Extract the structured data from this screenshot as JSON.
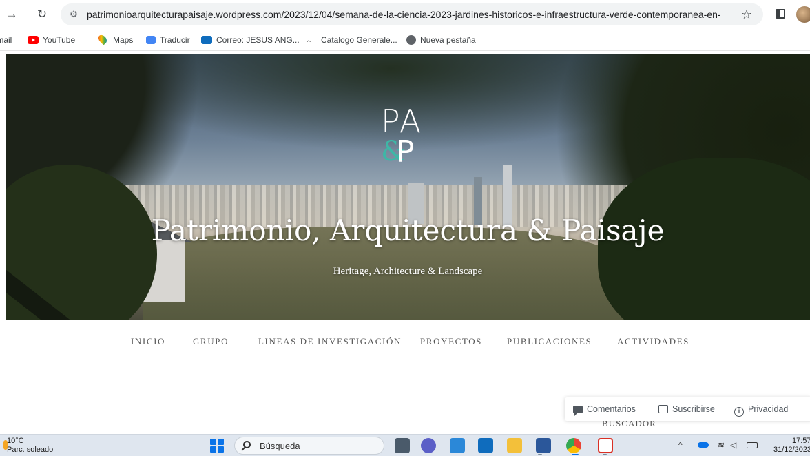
{
  "browser": {
    "url": "patrimonioarquitecturapaisaje.wordpress.com/2023/12/04/semana-de-la-ciencia-2023-jardines-historicos-e-infraestructura-verde-contemporanea-en-ma...",
    "bookmarks": [
      {
        "label": "Gmail",
        "icon": "gmail-icon"
      },
      {
        "label": "YouTube",
        "icon": "youtube-icon"
      },
      {
        "label": "Maps",
        "icon": "maps-icon"
      },
      {
        "label": "Traducir",
        "icon": "translate-icon"
      },
      {
        "label": "Correo: JESUS ANG...",
        "icon": "outlook-icon"
      },
      {
        "label": "Catalogo Generale...",
        "icon": "catalog-icon"
      },
      {
        "label": "Nueva pestaña",
        "icon": "new-tab-icon"
      }
    ]
  },
  "site": {
    "logo_top": "PA",
    "logo_amp": "&",
    "logo_bottom": "P",
    "title": "Patrimonio, Arquitectura & Paisaje",
    "tagline": "Heritage, Architecture & Landscape",
    "nav": [
      "INICIO",
      "GRUPO",
      "LINEAS DE INVESTIGACIÓN",
      "PROYECTOS",
      "PUBLICACIONES",
      "ACTIVIDADES"
    ],
    "sidebar_heading": "BUSCADOR"
  },
  "action_bar": {
    "comments": "Comentarios",
    "subscribe": "Suscribirse",
    "privacy": "Privacidad"
  },
  "taskbar": {
    "temperature": "10°C",
    "condition": "Parc. soleado",
    "search": "Búsqueda",
    "time": "17:57",
    "date": "31/12/2023",
    "apps": [
      "file-explorer-icon",
      "teams-icon",
      "calculator-icon",
      "mail-icon",
      "folder-icon",
      "word-icon",
      "chrome-icon",
      "acrobat-icon"
    ]
  },
  "colors": {
    "logo_accent": "#3fb6a6",
    "windows_blue": "#0a73e8",
    "youtube_red": "#ff0000"
  }
}
